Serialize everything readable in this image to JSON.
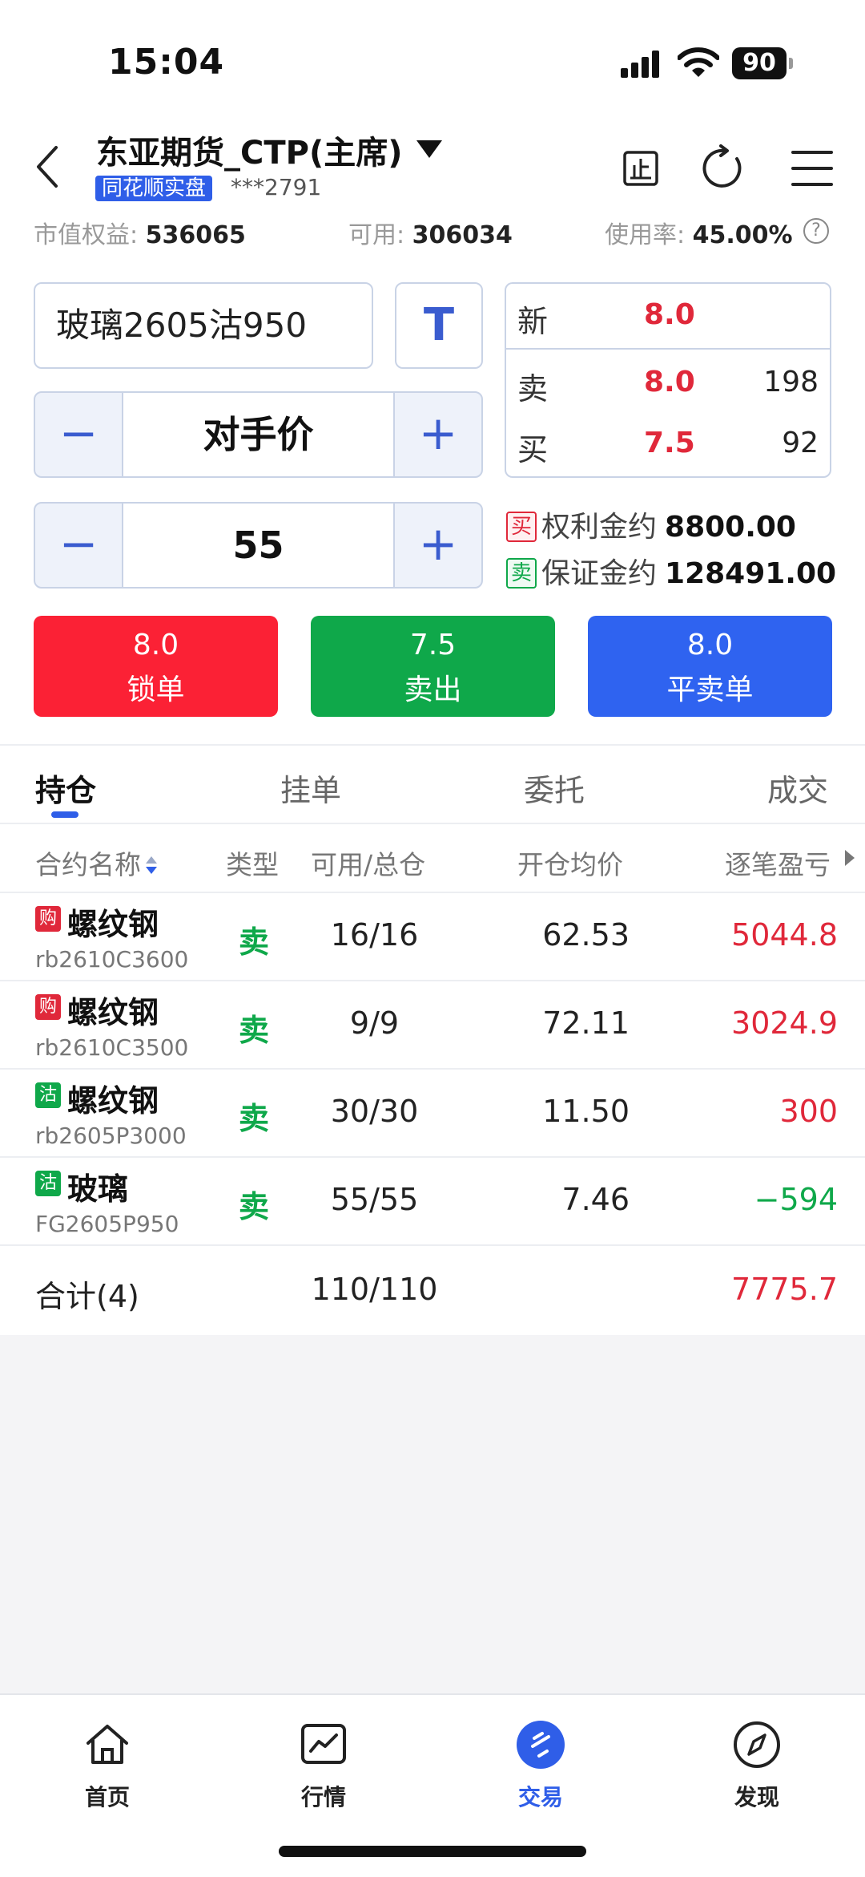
{
  "status": {
    "time": "15:04",
    "battery": "90"
  },
  "header": {
    "title": "东亚期货_CTP(主席)",
    "badge": "同花顺实盘",
    "account": "***2791"
  },
  "metrics": {
    "equity_label": "市值权益:",
    "equity_value": "536065",
    "available_label": "可用:",
    "available_value": "306034",
    "usage_label": "使用率:",
    "usage_value": "45.00%",
    "help_glyph": "?"
  },
  "order": {
    "contract": "玻璃2605沽950",
    "t_button": "T",
    "price_mode": "对手价",
    "quantity": "55",
    "minus_glyph": "−",
    "plus_glyph": "+"
  },
  "quote": {
    "new_label": "新",
    "new_price": "8.0",
    "sell_label": "卖",
    "sell_price": "8.0",
    "sell_volume": "198",
    "buy_label": "买",
    "buy_price": "7.5",
    "buy_volume": "92"
  },
  "info": {
    "buy_tag": "买",
    "right_label": "权利金约",
    "right_value": "8800.00",
    "sell_tag": "卖",
    "margin_label": "保证金约",
    "margin_value": "128491.00"
  },
  "actions": [
    {
      "price": "8.0",
      "label": "锁单",
      "color": "#fb2135"
    },
    {
      "price": "7.5",
      "label": "卖出",
      "color": "#0fa84a"
    },
    {
      "price": "8.0",
      "label": "平卖单",
      "color": "#2f63f0"
    }
  ],
  "tabs": [
    "持仓",
    "挂单",
    "委托",
    "成交"
  ],
  "table": {
    "headers": [
      "合约名称",
      "类型",
      "可用/总仓",
      "开仓均价",
      "逐笔盈亏"
    ],
    "rows": [
      {
        "flag": "购",
        "flag_color": "#e0283a",
        "name": "螺纹钢",
        "code": "rb2610C3600",
        "type": "卖",
        "position": "16/16",
        "avg_price": "62.53",
        "pnl": "5044.8",
        "pnl_color": "#e0283a"
      },
      {
        "flag": "购",
        "flag_color": "#e0283a",
        "name": "螺纹钢",
        "code": "rb2610C3500",
        "type": "卖",
        "position": "9/9",
        "avg_price": "72.11",
        "pnl": "3024.9",
        "pnl_color": "#e0283a"
      },
      {
        "flag": "沽",
        "flag_color": "#0fa84a",
        "name": "螺纹钢",
        "code": "rb2605P3000",
        "type": "卖",
        "position": "30/30",
        "avg_price": "11.50",
        "pnl": "300",
        "pnl_color": "#e0283a"
      },
      {
        "flag": "沽",
        "flag_color": "#0fa84a",
        "name": "玻璃",
        "code": "FG2605P950",
        "type": "卖",
        "position": "55/55",
        "avg_price": "7.46",
        "pnl": "−594",
        "pnl_color": "#0fa84a"
      }
    ],
    "total": {
      "label": "合计(4)",
      "position": "110/110",
      "pnl": "7775.7"
    }
  },
  "nav": [
    {
      "label": "首页",
      "icon": "home-icon"
    },
    {
      "label": "行情",
      "icon": "chart-icon"
    },
    {
      "label": "交易",
      "icon": "trade-icon"
    },
    {
      "label": "发现",
      "icon": "compass-icon"
    }
  ]
}
